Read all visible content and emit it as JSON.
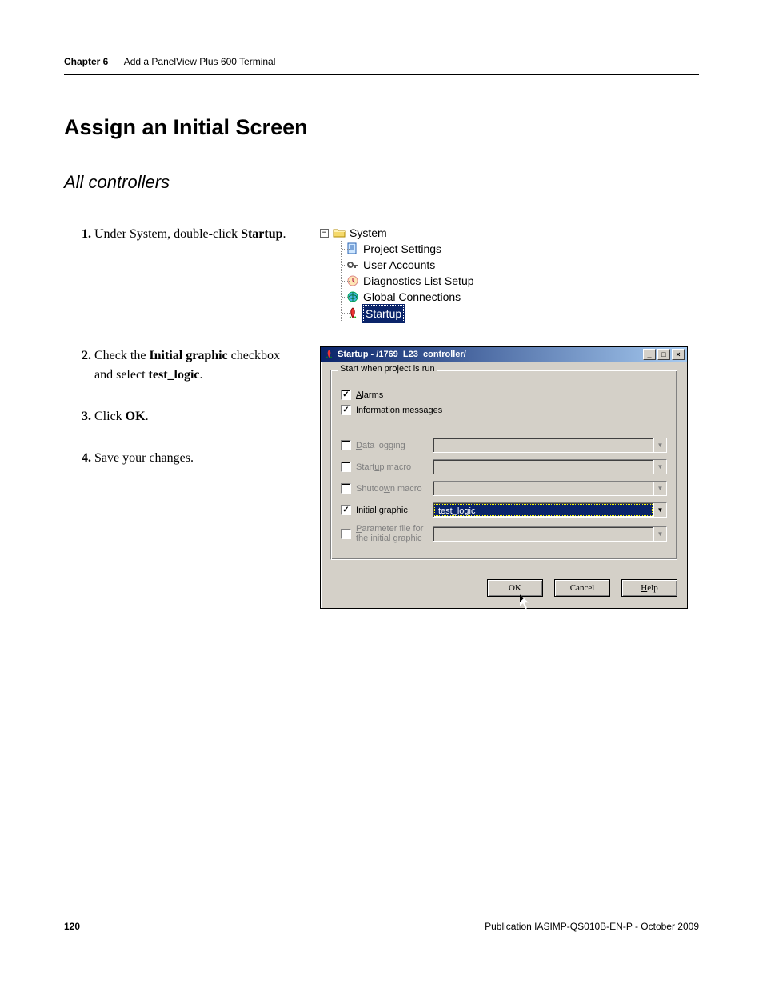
{
  "header": {
    "chapter": "Chapter 6",
    "title": "Add a PanelView Plus 600 Terminal"
  },
  "heading": "Assign an Initial Screen",
  "subheading": "All controllers",
  "steps": [
    {
      "pre": "Under System, double-click ",
      "bold": "Startup",
      "post": "."
    },
    {
      "pre": "Check the ",
      "bold": "Initial graphic",
      "mid": " checkbox and select ",
      "bold2": "test_logic",
      "post": "."
    },
    {
      "pre": "Click ",
      "bold": "OK",
      "post": "."
    },
    {
      "pre": "Save your changes.",
      "bold": "",
      "post": ""
    }
  ],
  "tree": {
    "root": "System",
    "children": [
      "Project Settings",
      "User Accounts",
      "Diagnostics List Setup",
      "Global Connections",
      "Startup"
    ],
    "selected": "Startup"
  },
  "dialog": {
    "title": "Startup - /1769_L23_controller/",
    "group_legend": "Start when project is run",
    "checks": {
      "alarms": {
        "label_u": "A",
        "label_rest": "larms",
        "checked": true,
        "enabled": true
      },
      "info": {
        "label_pre": "Information ",
        "label_u": "m",
        "label_rest": "essages",
        "checked": true,
        "enabled": true
      }
    },
    "combos": [
      {
        "key": "data_logging",
        "label_u": "D",
        "label_rest": "ata logging",
        "checked": false,
        "enabled": false,
        "value": ""
      },
      {
        "key": "startup_macro",
        "label_pre": "Start",
        "label_u": "u",
        "label_rest": "p macro",
        "checked": false,
        "enabled": false,
        "value": ""
      },
      {
        "key": "shutdown_macro",
        "label_pre": "Shutdo",
        "label_u": "w",
        "label_rest": "n macro",
        "checked": false,
        "enabled": false,
        "value": ""
      },
      {
        "key": "initial_graphic",
        "label_u": "I",
        "label_rest": "nitial graphic",
        "checked": true,
        "enabled": true,
        "value": "test_logic",
        "selected": true
      },
      {
        "key": "parameter_file",
        "label_u": "P",
        "label_rest": "arameter file for the initial graphic",
        "checked": false,
        "enabled": false,
        "value": ""
      }
    ],
    "buttons": {
      "ok": "OK",
      "cancel": "Cancel",
      "help_u": "H",
      "help_rest": "elp"
    }
  },
  "footer": {
    "page": "120",
    "pub": "Publication IASIMP-QS010B-EN-P - October 2009"
  }
}
